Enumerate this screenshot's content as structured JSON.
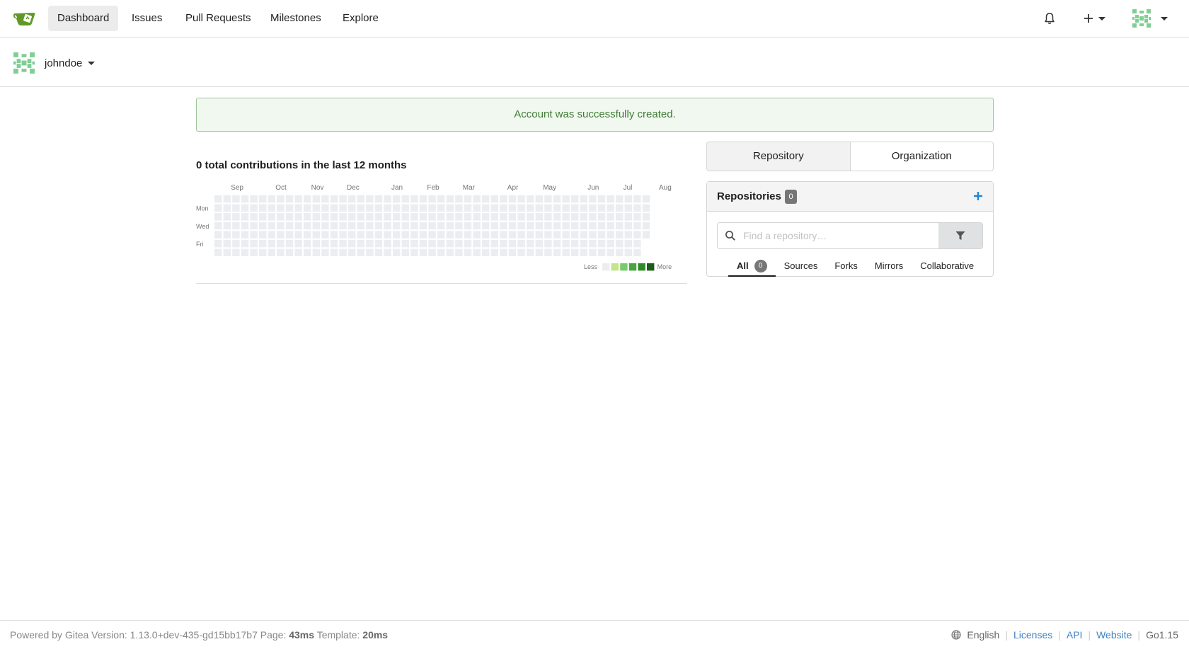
{
  "colors": {
    "accent": "#4183c4",
    "brand": "#609926",
    "flash_text": "#3f7a34",
    "heat_empty": "#ebedf0"
  },
  "nav": {
    "items": [
      {
        "label": "Dashboard",
        "active": true
      },
      {
        "label": "Issues"
      },
      {
        "label": "Pull Requests"
      },
      {
        "label": "Milestones"
      },
      {
        "label": "Explore"
      }
    ]
  },
  "context": {
    "username": "johndoe"
  },
  "flash": {
    "message": "Account was successfully created."
  },
  "heatmap": {
    "title": "0 total contributions in the last 12 months",
    "months": [
      "Sep",
      "Oct",
      "Nov",
      "Dec",
      "Jan",
      "Feb",
      "Mar",
      "Apr",
      "May",
      "Jun",
      "Jul",
      "Aug"
    ],
    "days": [
      "Mon",
      "Wed",
      "Fri"
    ],
    "legend_less": "Less",
    "legend_more": "More",
    "total": 0
  },
  "switcher": {
    "repository": "Repository",
    "organization": "Organization"
  },
  "repos": {
    "title": "Repositories",
    "count": "0",
    "search_placeholder": "Find a repository…",
    "tabs": [
      {
        "label": "All",
        "count": "0",
        "active": true
      },
      {
        "label": "Sources"
      },
      {
        "label": "Forks"
      },
      {
        "label": "Mirrors"
      },
      {
        "label": "Collaborative"
      }
    ]
  },
  "footer": {
    "powered": "Powered by Gitea Version: 1.13.0+dev-435-gd15bb17b7 Page:",
    "page_time": "43ms",
    "template_label": "Template:",
    "template_time": "20ms",
    "language": "English",
    "licenses": "Licenses",
    "api": "API",
    "website": "Website",
    "go": "Go1.15"
  }
}
